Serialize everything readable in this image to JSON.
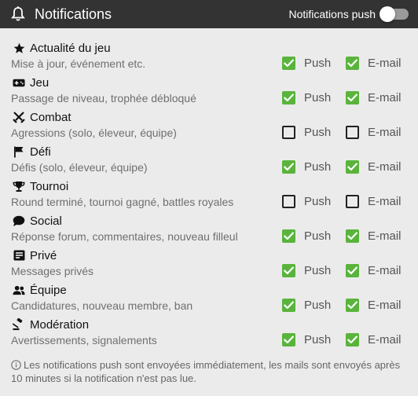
{
  "header": {
    "title": "Notifications",
    "push_label": "Notifications push",
    "push_enabled": false,
    "icon": "bell-icon"
  },
  "colors": {
    "header_bg": "#333333",
    "checked": "#5ab43c",
    "panel_bg": "#ebebeb"
  },
  "options": {
    "push_label": "Push",
    "mail_label": "E-mail"
  },
  "categories": [
    {
      "key": "news",
      "icon": "star-icon",
      "title": "Actualité du jeu",
      "desc": "Mise à jour, événement etc.",
      "push": true,
      "mail": true
    },
    {
      "key": "game",
      "icon": "gamepad-icon",
      "title": "Jeu",
      "desc": "Passage de niveau, trophée débloqué",
      "push": true,
      "mail": true
    },
    {
      "key": "combat",
      "icon": "swords-icon",
      "title": "Combat",
      "desc": "Agressions (solo, éleveur, équipe)",
      "push": false,
      "mail": false
    },
    {
      "key": "challenge",
      "icon": "flag-icon",
      "title": "Défi",
      "desc": "Défis (solo, éleveur, équipe)",
      "push": true,
      "mail": true
    },
    {
      "key": "tournament",
      "icon": "trophy-icon",
      "title": "Tournoi",
      "desc": "Round terminé, tournoi gagné, battles royales",
      "push": false,
      "mail": false
    },
    {
      "key": "social",
      "icon": "speech-bubble-icon",
      "title": "Social",
      "desc": "Réponse forum, commentaires, nouveau filleul",
      "push": true,
      "mail": true
    },
    {
      "key": "private",
      "icon": "inbox-icon",
      "title": "Privé",
      "desc": "Messages privés",
      "push": true,
      "mail": true
    },
    {
      "key": "team",
      "icon": "users-icon",
      "title": "Équipe",
      "desc": "Candidatures, nouveau membre, ban",
      "push": true,
      "mail": true
    },
    {
      "key": "moderation",
      "icon": "gavel-icon",
      "title": "Modération",
      "desc": "Avertissements, signalements",
      "push": true,
      "mail": true
    }
  ],
  "footer": {
    "icon": "info-icon",
    "text": "Les notifications push sont envoyées immédiatement, les mails sont envoyés après 10 minutes si la notification n'est pas lue."
  }
}
